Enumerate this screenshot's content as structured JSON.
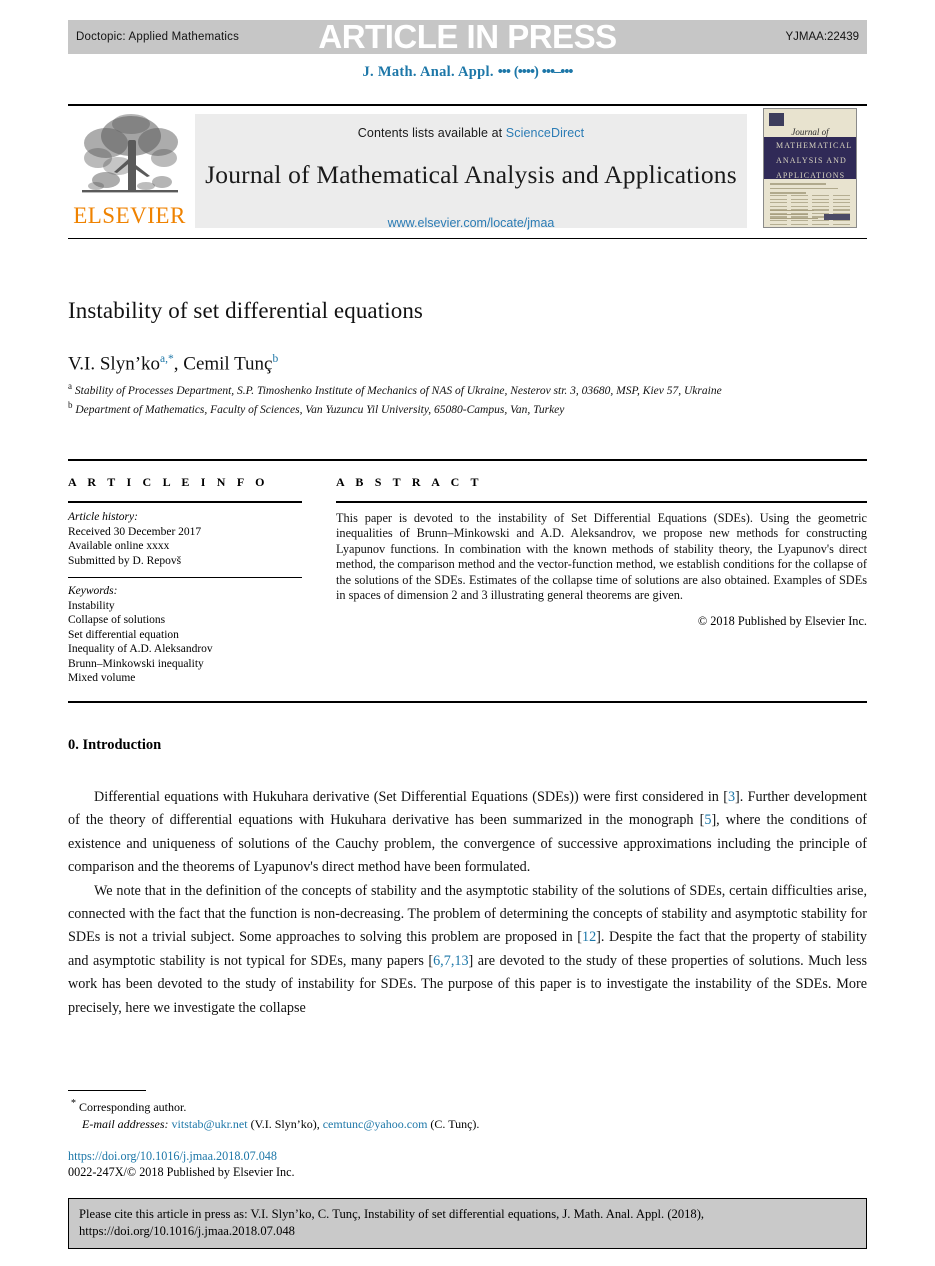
{
  "header": {
    "doctopic": "Doctopic: Applied Mathematics",
    "press_stamp": "ARTICLE IN PRESS",
    "article_number": "YJMAA:22439",
    "journal_ref_prefix": "J. Math. Anal. Appl.",
    "journal_ref_vol": "•••",
    "journal_ref_issue": "(••••)",
    "journal_ref_pages": "•••–•••"
  },
  "masthead": {
    "contents_prefix": "Contents lists available at",
    "sciencedirect": "ScienceDirect",
    "journal_name": "Journal of Mathematical Analysis and Applications",
    "journal_url": "www.elsevier.com/locate/jmaa",
    "publisher": "ELSEVIER",
    "cover": {
      "journal_of": "Journal of",
      "line1": "MATHEMATICAL",
      "line2": "ANALYSIS AND",
      "line3": "APPLICATIONS"
    }
  },
  "article": {
    "title": "Instability of set differential equations",
    "authors_plain": "V.I. Slyn’ko",
    "author1_sup": "a,*",
    "authors_second": ", Cemil Tunç",
    "author2_sup": "b",
    "affiliation_a_marker": "a",
    "affiliation_a": "Stability of Processes Department, S.P. Timoshenko Institute of Mechanics of NAS of Ukraine, Nesterov str. 3, 03680, MSP, Kiev 57, Ukraine",
    "affiliation_b_marker": "b",
    "affiliation_b": "Department of Mathematics, Faculty of Sciences, Van Yuzuncu Yil University, 65080-Campus, Van, Turkey"
  },
  "article_info": {
    "label": "A R T I C L E   I N F O",
    "history_label": "Article history:",
    "history": [
      "Received 30 December 2017",
      "Available online xxxx",
      "Submitted by D. Repovš"
    ],
    "keywords_label": "Keywords:",
    "keywords": [
      "Instability",
      "Collapse of solutions",
      "Set differential equation",
      "Inequality of A.D. Aleksandrov",
      "Brunn–Minkowski inequality",
      "Mixed volume"
    ]
  },
  "abstract": {
    "label": "A B S T R A C T",
    "text": "This paper is devoted to the instability of Set Differential Equations (SDEs). Using the geometric inequalities of Brunn–Minkowski and A.D. Aleksandrov, we propose new methods for constructing Lyapunov functions. In combination with the known methods of stability theory, the Lyapunov's direct method, the comparison method and the vector-function method, we establish conditions for the collapse of the solutions of the SDEs. Estimates of the collapse time of solutions are also obtained. Examples of SDEs in spaces of dimension 2 and 3 illustrating general theorems are given.",
    "copyright": "© 2018 Published by Elsevier Inc."
  },
  "body": {
    "section_heading": "0. Introduction",
    "para1_a": "Differential equations with Hukuhara derivative (Set Differential Equations (SDEs)) were first considered in [",
    "para1_ref1": "3",
    "para1_b": "]. Further development of the theory of differential equations with Hukuhara derivative has been summarized in the monograph [",
    "para1_ref2": "5",
    "para1_c": "], where the conditions of existence and uniqueness of solutions of the Cauchy problem, the convergence of successive approximations including the principle of comparison and the theorems of Lyapunov's direct method have been formulated.",
    "para2_a": "We note that in the definition of the concepts of stability and the asymptotic stability of the solutions of SDEs, certain difficulties arise, connected with the fact that the function is non-decreasing. The problem of determining the concepts of stability and asymptotic stability for SDEs is not a trivial subject. Some approaches to solving this problem are proposed in [",
    "para2_ref1": "12",
    "para2_b": "]. Despite the fact that the property of stability and asymptotic stability is not typical for SDEs, many papers [",
    "para2_ref2": "6,7,13",
    "para2_c": "] are devoted to the study of these properties of solutions. Much less work has been devoted to the study of instability for SDEs. The purpose of this paper is to investigate the instability of the SDEs. More precisely, here we investigate the collapse"
  },
  "footnotes": {
    "star_marker": "*",
    "corresponding": "Corresponding author.",
    "email_label": "E-mail addresses:",
    "email1": "vitstab@ukr.net",
    "email1_owner": "(V.I. Slyn’ko),",
    "email2": "cemtunc@yahoo.com",
    "email2_owner": "(C. Tunç).",
    "doi": "https://doi.org/10.1016/j.jmaa.2018.07.048",
    "issn_line": "0022-247X/© 2018 Published by Elsevier Inc."
  },
  "cite_box": {
    "line1": "Please cite this article in press as: V.I. Slyn’ko, C. Tunç, Instability of set differential equations, J. Math. Anal. Appl. (2018),",
    "line2": "https://doi.org/10.1016/j.jmaa.2018.07.048"
  },
  "colors": {
    "link": "#1d77a8",
    "band": "#c6c6c6",
    "sd_panel": "#ececec",
    "elsevier_orange": "#ef8200",
    "cover_band": "#302a57",
    "cite_bg": "#c9c9c9"
  }
}
